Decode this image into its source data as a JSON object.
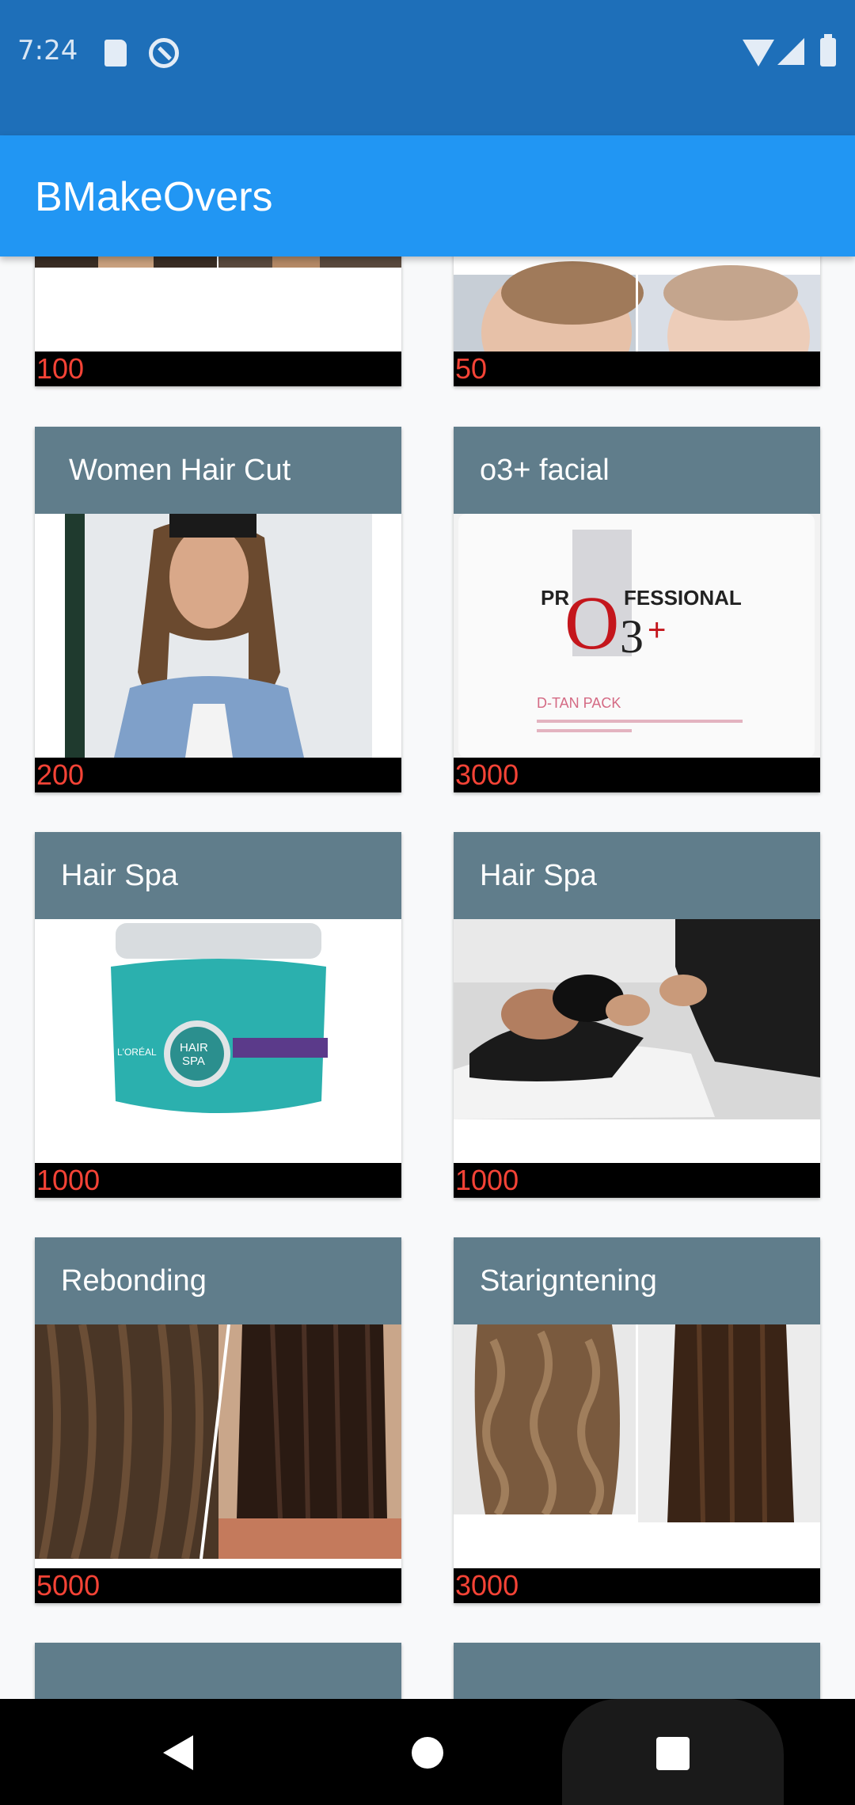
{
  "status_bar": {
    "time": "7:24",
    "icons": [
      "sd-card-icon",
      "do-not-disturb-icon",
      "wifi-icon",
      "signal-icon",
      "battery-icon"
    ]
  },
  "app_bar": {
    "title": "BMakeOvers",
    "color": "#2196f3"
  },
  "colors": {
    "card_header": "#607d8b",
    "price_text": "#f44336",
    "price_bg": "#000000"
  },
  "services": [
    {
      "title": "",
      "price": "100",
      "image": "hair-cut-photo"
    },
    {
      "title": "",
      "price": "50",
      "image": "boy-haircut-photo"
    },
    {
      "title": "Women Hair Cut",
      "price": "200",
      "image": "women-haircut-photo"
    },
    {
      "title": "o3+ facial",
      "price": "3000",
      "image": "o3-professional-tub-photo"
    },
    {
      "title": "Hair Spa",
      "price": "1000",
      "image": "loreal-hair-spa-jar-photo"
    },
    {
      "title": "Hair Spa",
      "price": "1000",
      "image": "hair-wash-salon-photo"
    },
    {
      "title": "Rebonding",
      "price": "5000",
      "image": "rebonding-before-after-photo"
    },
    {
      "title": "Starigntening",
      "price": "3000",
      "image": "straightening-before-after-photo"
    }
  ],
  "nav_bar": {
    "buttons": [
      "back-icon",
      "home-icon",
      "recent-apps-icon"
    ]
  }
}
